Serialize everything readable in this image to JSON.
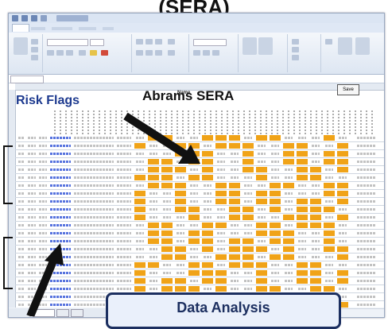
{
  "slide": {
    "title": "(SERA)",
    "annotation_label": "Risk Flags",
    "callout_text": "Data Analysis"
  },
  "excel": {
    "sheet_title_small": "Name",
    "sheet_title": "Abrams SERA",
    "sheet_button_label": "Save"
  },
  "colors": {
    "flag_orange": "#f0a318",
    "annotation_blue": "#1d3a8f",
    "callout_border": "#1c2f60"
  },
  "icons": [
    "save-icon",
    "undo-icon",
    "redo-icon",
    "paste-icon",
    "bold-icon",
    "font-color-icon",
    "sort-icon",
    "find-icon"
  ]
}
